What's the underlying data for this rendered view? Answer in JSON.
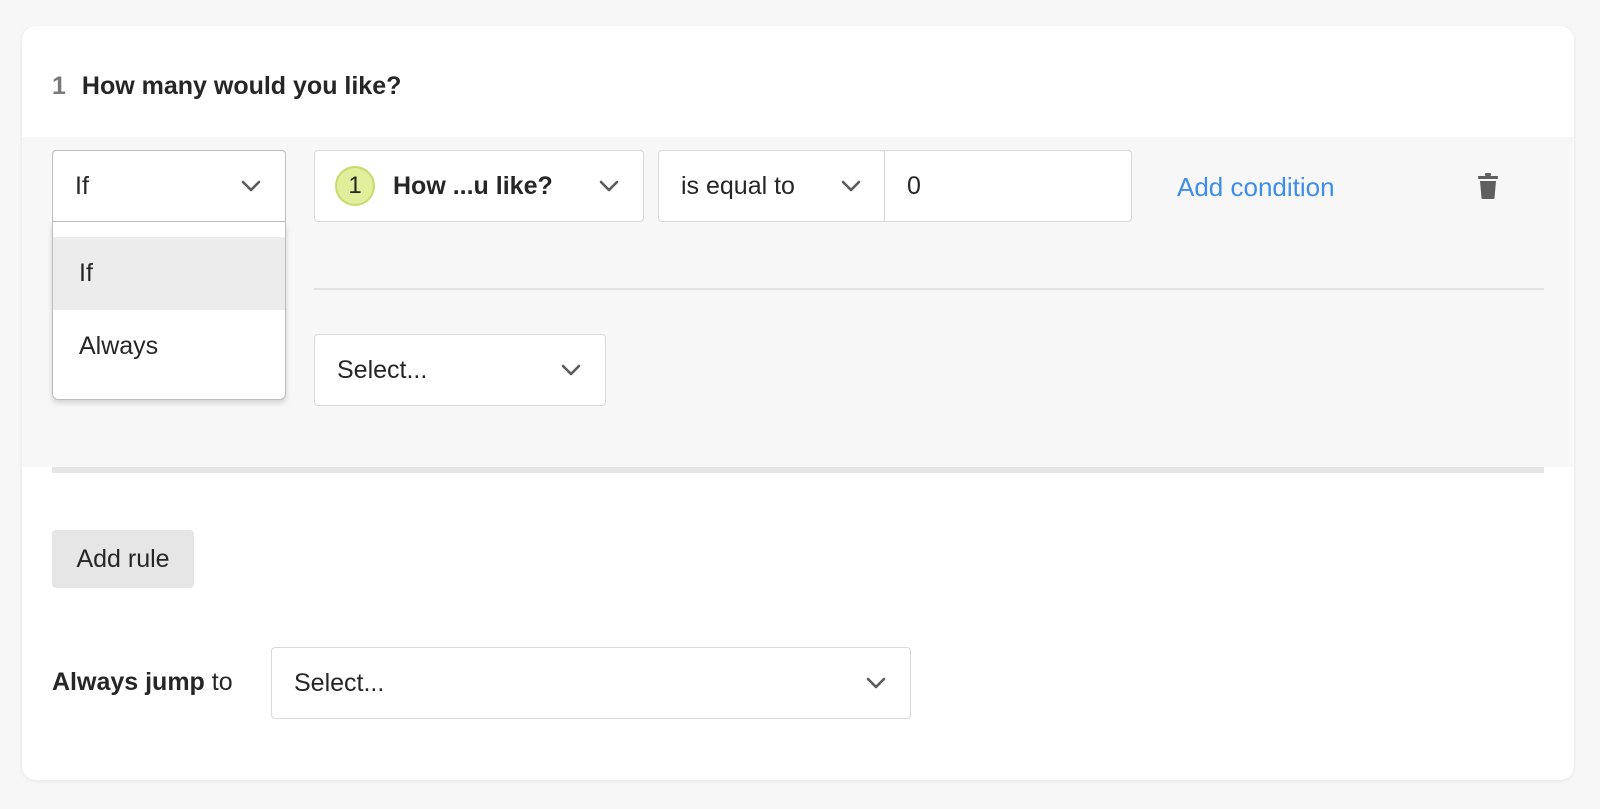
{
  "question": {
    "number": "1",
    "title": "How many would you like?"
  },
  "rule": {
    "type_select": {
      "value": "If",
      "options": [
        "If",
        "Always"
      ],
      "selected_index": 0
    },
    "condition": {
      "question_badge": "1",
      "question_label": "How ...u like?",
      "operator": "is equal to",
      "value": "0"
    },
    "add_condition_label": "Add condition",
    "then_select_placeholder": "Select..."
  },
  "add_rule_label": "Add rule",
  "always_jump": {
    "bold_label": "Always jump",
    "suffix_label": " to",
    "select_placeholder": "Select..."
  },
  "icons": {
    "chevron": "chevron-down-icon",
    "trash": "trash-icon"
  },
  "colors": {
    "link": "#3d8ee8",
    "badge_fill": "#e1ee9c",
    "rule_background": "#f7f7f7"
  }
}
